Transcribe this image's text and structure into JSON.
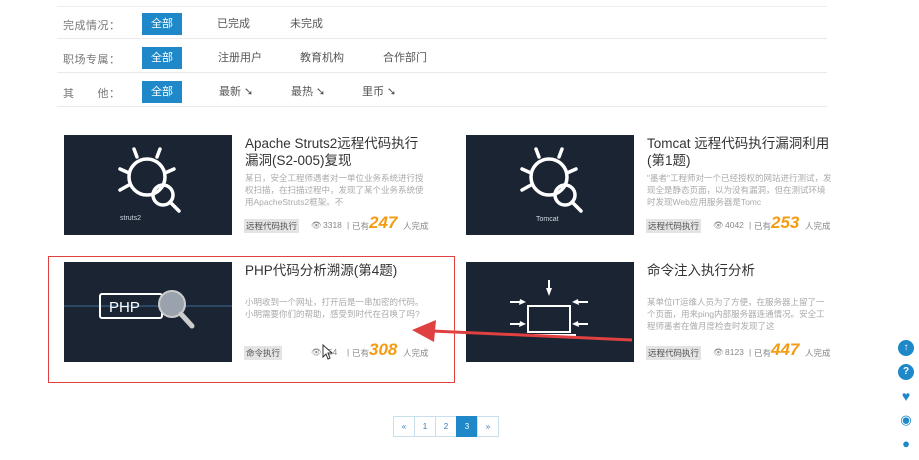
{
  "filters": [
    {
      "label": "完成情况：",
      "options": [
        "全部",
        "已完成",
        "未完成"
      ]
    },
    {
      "label": "职场专属：",
      "options": [
        "全部",
        "注册用户",
        "教育机构",
        "合作部门"
      ]
    },
    {
      "label": "其　　他：",
      "options": [
        "全部",
        "最新",
        "最热",
        "里币"
      ]
    }
  ],
  "cards": [
    {
      "title": "Apache Struts2远程代码执行漏洞(S2-005)复现",
      "thumb_label": "struts2",
      "desc": "某日，安全工程师遇者对一单位业务系统进行授权扫描，在扫描过程中，发现了某个业务系统使用ApacheStruts2框架。不",
      "tag": "远程代码执行",
      "views": "3318",
      "sep": "|",
      "has_done": "已有",
      "count": "247",
      "done": "人完成"
    },
    {
      "title": "Tomcat 远程代码执行漏洞利用(第1题)",
      "thumb_label": "Tomcat",
      "desc": "\"墨者\"工程师对一个已经授权的网站进行测试，发现全是静态页面，以为没有漏洞，但在测试环境时发现Web应用服务器是Tomc",
      "tag": "远程代码执行",
      "views": "4042",
      "sep": "|",
      "has_done": "已有",
      "count": "253",
      "done": "人完成"
    },
    {
      "title": "PHP代码分析溯源(第4题)",
      "thumb_label": "PHP",
      "desc": "小明收到一个网址，打开后是一串加密的代码。小明需要你们的帮助，感受到时代在召唤了吗?",
      "tag": "命令执行",
      "views": "854",
      "sep": "|",
      "has_done": "已有",
      "count": "308",
      "done": "人完成"
    },
    {
      "title": "命令注入执行分析",
      "thumb_label": "",
      "desc": "某单位IT运维人员为了方便，在服务器上留了一个页面，用来ping内部服务器连通情况。安全工程师墨者在做月度检查时发现了这",
      "tag": "远程代码执行",
      "views": "8123",
      "sep": "|",
      "has_done": "已有",
      "count": "447",
      "done": "人完成"
    }
  ],
  "pagination": [
    "«",
    "1",
    "2",
    "3",
    "»"
  ],
  "pagination_active": "3",
  "sidebar_icons": [
    "top-icon",
    "help-icon",
    "heart-icon",
    "weibo-icon",
    "wechat-icon"
  ],
  "colors": {
    "accent": "#1e88c9",
    "count": "#f39c12",
    "annotation": "#e04040"
  }
}
